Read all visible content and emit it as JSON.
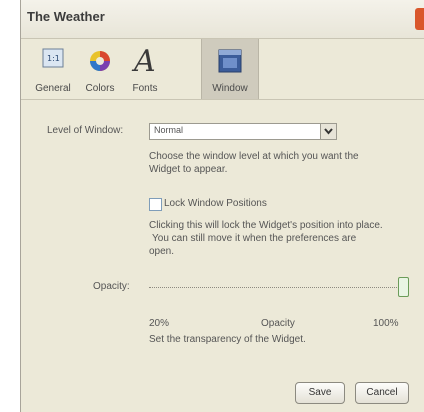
{
  "window": {
    "title": "The Weather"
  },
  "toolbar": {
    "items": [
      {
        "label": "General",
        "icon": "general-icon"
      },
      {
        "label": "Colors",
        "icon": "color-wheel-icon"
      },
      {
        "label": "Fonts",
        "icon": "font-icon"
      },
      {
        "label": "Window",
        "icon": "window-icon",
        "active": true
      }
    ]
  },
  "level": {
    "label": "Level of Window:",
    "value": "Normal",
    "help": [
      "Choose the window level at which you want the",
      "Widget to appear."
    ]
  },
  "lock": {
    "label": "Lock Window Positions",
    "checked": false,
    "help": [
      "Clicking this will lock the Widget's position into place.",
      "You can still move it when the preferences are",
      "open."
    ]
  },
  "opacity": {
    "label": "Opacity:",
    "value_percent": 100,
    "min_label": "20%",
    "mid_label": "Opacity",
    "max_label": "100%",
    "help": "Set the transparency of the Widget."
  },
  "buttons": {
    "save": "Save",
    "cancel": "Cancel"
  }
}
